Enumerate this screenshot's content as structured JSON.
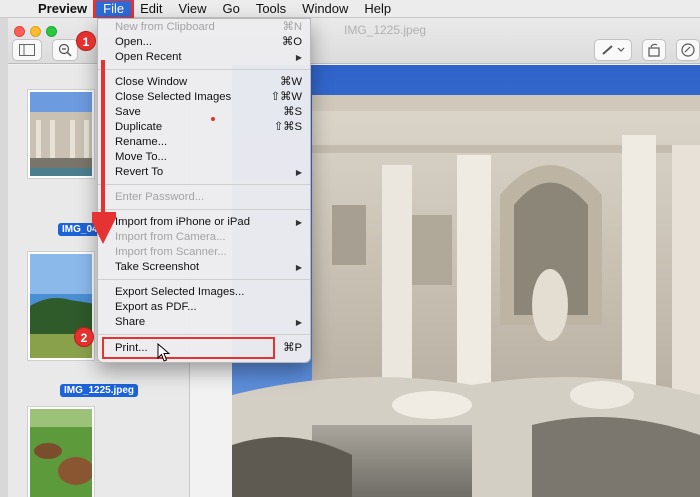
{
  "menubar": {
    "app_name": "Preview",
    "items": [
      "File",
      "Edit",
      "View",
      "Go",
      "Tools",
      "Window",
      "Help"
    ]
  },
  "window": {
    "title": "IMG_1225.jpeg"
  },
  "sidebar": {
    "thumbnails": [
      {
        "label": "IMG_04"
      },
      {
        "label": "IMG_1225.jpeg"
      },
      {
        "label": ""
      }
    ]
  },
  "file_menu": {
    "items": [
      {
        "label": "New from Clipboard",
        "shortcut": "⌘N",
        "disabled": true
      },
      {
        "label": "Open...",
        "shortcut": "⌘O"
      },
      {
        "label": "Open Recent",
        "submenu": true
      },
      {
        "label": "Close Window",
        "shortcut": "⌘W"
      },
      {
        "label": "Close Selected Images",
        "shortcut": "⇧⌘W"
      },
      {
        "label": "Save",
        "shortcut": "⌘S"
      },
      {
        "label": "Duplicate",
        "shortcut": "⇧⌘S"
      },
      {
        "label": "Rename..."
      },
      {
        "label": "Move To..."
      },
      {
        "label": "Revert To",
        "submenu": true
      },
      {
        "label": "Enter Password...",
        "disabled": true
      },
      {
        "label": "Import from iPhone or iPad",
        "submenu": true
      },
      {
        "label": "Import from Camera...",
        "disabled": true
      },
      {
        "label": "Import from Scanner...",
        "disabled": true
      },
      {
        "label": "Take Screenshot",
        "submenu": true
      },
      {
        "label": "Export Selected Images..."
      },
      {
        "label": "Export as PDF..."
      },
      {
        "label": "Share",
        "submenu": true
      },
      {
        "label": "Print...",
        "shortcut": "⌘P"
      }
    ]
  },
  "annotations": {
    "step1": "1",
    "step2": "2",
    "accent": "#e53232"
  },
  "icons": {
    "apple": "apple-icon",
    "submenu_arrow": "▶",
    "cursor": "pointer-cursor-icon"
  }
}
